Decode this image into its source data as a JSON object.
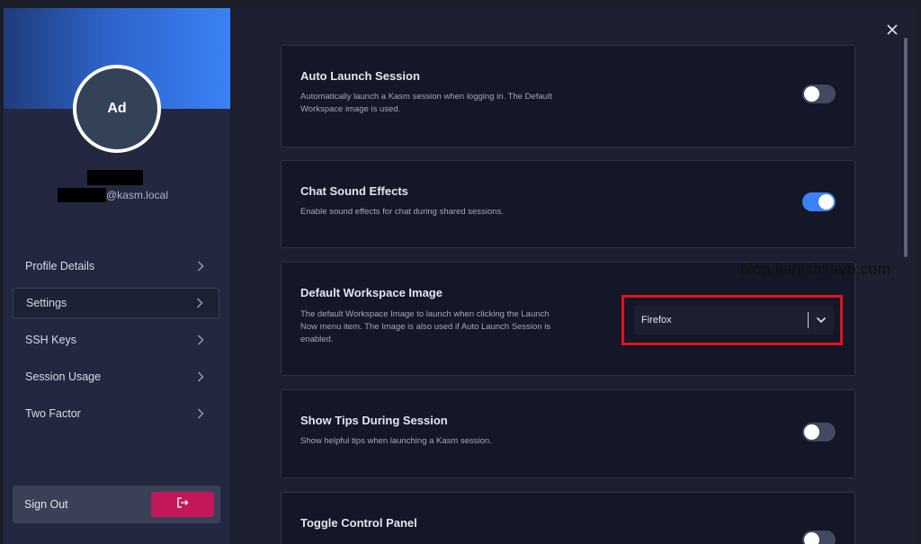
{
  "user": {
    "initials": "Ad",
    "email_suffix": "@kasm.local"
  },
  "sidebar": {
    "items": [
      {
        "label": "Profile Details"
      },
      {
        "label": "Settings"
      },
      {
        "label": "SSH Keys"
      },
      {
        "label": "Session Usage"
      },
      {
        "label": "Two Factor"
      }
    ],
    "sign_out_label": "Sign Out"
  },
  "settings": {
    "auto_launch": {
      "title": "Auto Launch Session",
      "description": "Automatically launch a Kasm session when logging in. The Default Workspace image is used.",
      "enabled": false
    },
    "chat_sound": {
      "title": "Chat Sound Effects",
      "description": "Enable sound effects for chat during shared sessions.",
      "enabled": true
    },
    "default_image": {
      "title": "Default Workspace Image",
      "description": "The default Workspace Image to launch when clicking the Launch Now menu item. The Image is also used if Auto Launch Session is enabled.",
      "selected": "Firefox"
    },
    "show_tips": {
      "title": "Show Tips During Session",
      "description": "Show helpful tips when launching a Kasm session.",
      "enabled": false
    },
    "toggle_control_panel": {
      "title": "Toggle Control Panel"
    }
  },
  "colors": {
    "accent": "#3b82f6",
    "sign_out_button": "#c2185b",
    "highlight": "#e5111c"
  },
  "watermark": "blog.kanishkavb.com"
}
